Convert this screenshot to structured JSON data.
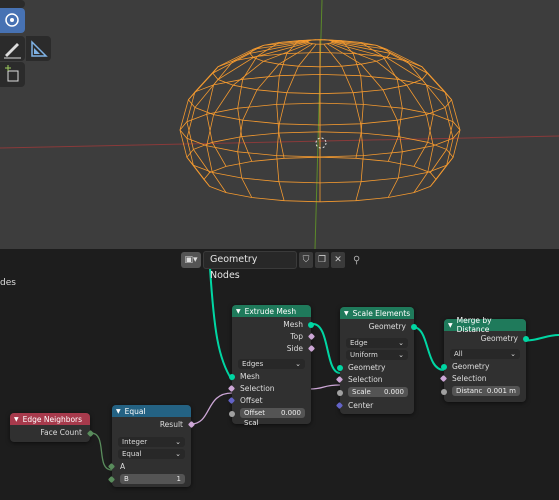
{
  "viewport": {
    "tools": [
      {
        "icon": "move-icon"
      },
      {
        "icon": "scale-icon"
      },
      {
        "icon": "annotate-icon"
      },
      {
        "icon": "measure-icon"
      },
      {
        "icon": "add-cube-icon"
      }
    ]
  },
  "editor": {
    "tree_name": "Geometry Nodes",
    "truncated_label": "des"
  },
  "nodes": {
    "edge_neighbors": {
      "title": "Edge Neighbors",
      "outputs": [
        "Face Count"
      ]
    },
    "equal": {
      "title": "Equal",
      "output": "Result",
      "type_option": "Integer",
      "mode_option": "Equal",
      "input_a": "A",
      "input_b_label": "B",
      "input_b_value": "1"
    },
    "extrude": {
      "title": "Extrude Mesh",
      "outputs": [
        "Mesh",
        "Top",
        "Side"
      ],
      "mode": "Edges",
      "inputs": [
        "Mesh",
        "Selection",
        "Offset"
      ],
      "offset_scale_label": "Offset Scal",
      "offset_scale_value": "0.000"
    },
    "scale": {
      "title": "Scale Elements",
      "output": "Geometry",
      "domain": "Edge",
      "scale_mode": "Uniform",
      "inputs": [
        "Geometry",
        "Selection"
      ],
      "scale_label": "Scale",
      "scale_value": "0.000",
      "center": "Center"
    },
    "merge": {
      "title": "Merge by Distance",
      "output": "Geometry",
      "mode": "All",
      "inputs": [
        "Geometry",
        "Selection"
      ],
      "distance_label": "Distanc",
      "distance_value": "0.001 m"
    }
  },
  "colors": {
    "input_header": "#a73a4c",
    "utility_header": "#246283",
    "geometry_header": "#1f7a5b",
    "wire": "#f59a2f",
    "geometry_link": "#00d6a3"
  }
}
